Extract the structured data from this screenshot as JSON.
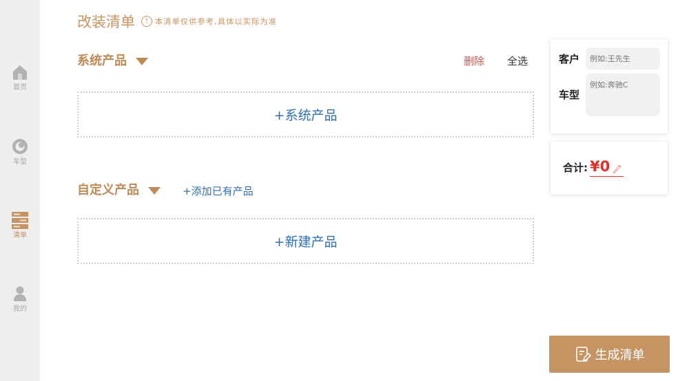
{
  "colors": {
    "accent": "#c69463",
    "link": "#2f6fb3",
    "danger": "#d9534f",
    "total": "#e0302a",
    "sidebar_bg": "#eeeeee"
  },
  "sidebar": {
    "items": [
      {
        "label": "首页",
        "icon": "home-icon",
        "active": false
      },
      {
        "label": "车型",
        "icon": "car-model-icon",
        "active": false
      },
      {
        "label": "清单",
        "icon": "list-icon",
        "active": true
      },
      {
        "label": "我的",
        "icon": "user-icon",
        "active": false
      }
    ]
  },
  "header": {
    "title": "改装清单",
    "notice_icon": "!",
    "notice": "本清单仅供参考,具体以实际为准"
  },
  "system_section": {
    "title": "系统产品",
    "delete_label": "删除",
    "select_all_label": "全选",
    "add_label": "+系统产品"
  },
  "custom_section": {
    "title": "自定义产品",
    "add_existing_label": "+添加已有产品",
    "new_label": "+新建产品"
  },
  "customer": {
    "customer_label": "客户",
    "customer_placeholder": "例如:王先生",
    "car_label": "车型",
    "car_placeholder": "例如:奔驰C"
  },
  "total": {
    "label": "合计:",
    "amount": "¥0",
    "edit_icon": "pencil-icon"
  },
  "generate_button": {
    "label": "生成清单",
    "icon": "document-edit-icon"
  }
}
